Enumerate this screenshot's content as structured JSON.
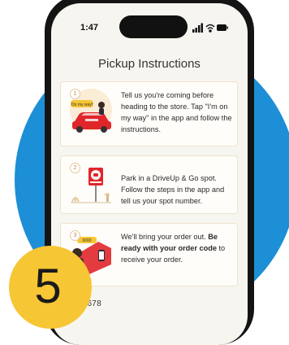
{
  "status_bar": {
    "time": "1:47"
  },
  "page": {
    "title": "Pickup Instructions"
  },
  "steps": [
    {
      "number": "1",
      "art_label": "On my way!",
      "text_plain": "Tell us you're coming before heading to the store. Tap \"I'm on my way\" in the app and follow the instructions."
    },
    {
      "number": "2",
      "text_plain": "Park in a DriveUp & Go spot. Follow the steps in the app and tell us your spot number."
    },
    {
      "number": "3",
      "art_label": "0000",
      "text_before": "We'll bring your order out. ",
      "text_bold": "Be ready with your order code",
      "text_after": " to receive your order."
    }
  ],
  "footer": {
    "order_code": "2345678"
  },
  "badge": {
    "number": "5"
  },
  "colors": {
    "background_circle": "#1d8fd6",
    "badge": "#f7c634",
    "accent_red": "#e0262b",
    "card_border": "#eee3cf"
  }
}
